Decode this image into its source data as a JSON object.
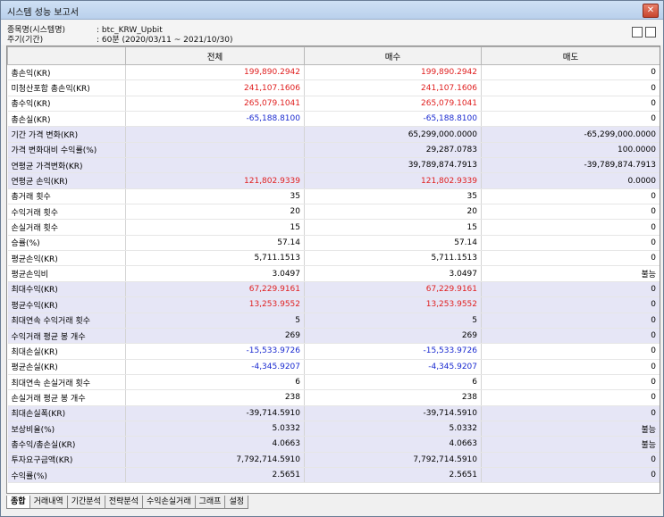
{
  "window": {
    "title": "시스템 성능 보고서",
    "close": "✕"
  },
  "info": {
    "name_label": "종목명(시스템명)",
    "name_value": ": btc_KRW_Upbit",
    "period_label": "주기(기간)",
    "period_value": ": 60분 (2020/03/11 ~ 2021/10/30)"
  },
  "table": {
    "headers": [
      "",
      "전체",
      "매수",
      "매도"
    ],
    "rows": [
      {
        "label": "총손익(KR)",
        "v": [
          "199,890.2942",
          "199,890.2942",
          "0"
        ],
        "c": [
          "red",
          "red",
          ""
        ],
        "hl": false
      },
      {
        "label": "미청산포함 총손익(KR)",
        "v": [
          "241,107.1606",
          "241,107.1606",
          "0"
        ],
        "c": [
          "red",
          "red",
          ""
        ],
        "hl": false
      },
      {
        "label": "총수익(KR)",
        "v": [
          "265,079.1041",
          "265,079.1041",
          "0"
        ],
        "c": [
          "red",
          "red",
          ""
        ],
        "hl": false
      },
      {
        "label": "총손실(KR)",
        "v": [
          "-65,188.8100",
          "-65,188.8100",
          "0"
        ],
        "c": [
          "blue",
          "blue",
          ""
        ],
        "hl": false
      },
      {
        "label": "기간 가격 변화(KR)",
        "v": [
          "",
          "65,299,000.0000",
          "-65,299,000.0000"
        ],
        "c": [
          "",
          "",
          ""
        ],
        "hl": true
      },
      {
        "label": "가격 변화대비 수익률(%)",
        "v": [
          "",
          "29,287.0783",
          "100.0000"
        ],
        "c": [
          "",
          "",
          ""
        ],
        "hl": true
      },
      {
        "label": "연평균 가격변화(KR)",
        "v": [
          "",
          "39,789,874.7913",
          "-39,789,874.7913"
        ],
        "c": [
          "",
          "",
          ""
        ],
        "hl": true
      },
      {
        "label": "연평균 손익(KR)",
        "v": [
          "121,802.9339",
          "121,802.9339",
          "0.0000"
        ],
        "c": [
          "red",
          "red",
          ""
        ],
        "hl": true
      },
      {
        "label": "총거래 횟수",
        "v": [
          "35",
          "35",
          "0"
        ],
        "c": [
          "",
          "",
          ""
        ],
        "hl": false
      },
      {
        "label": "수익거래 횟수",
        "v": [
          "20",
          "20",
          "0"
        ],
        "c": [
          "",
          "",
          ""
        ],
        "hl": false
      },
      {
        "label": "손실거래 횟수",
        "v": [
          "15",
          "15",
          "0"
        ],
        "c": [
          "",
          "",
          ""
        ],
        "hl": false
      },
      {
        "label": "승률(%)",
        "v": [
          "57.14",
          "57.14",
          "0"
        ],
        "c": [
          "",
          "",
          ""
        ],
        "hl": false
      },
      {
        "label": "평균손익(KR)",
        "v": [
          "5,711.1513",
          "5,711.1513",
          "0"
        ],
        "c": [
          "",
          "",
          ""
        ],
        "hl": false
      },
      {
        "label": "평균손익비",
        "v": [
          "3.0497",
          "3.0497",
          "불능"
        ],
        "c": [
          "",
          "",
          ""
        ],
        "hl": false
      },
      {
        "label": "최대수익(KR)",
        "v": [
          "67,229.9161",
          "67,229.9161",
          "0"
        ],
        "c": [
          "red",
          "red",
          ""
        ],
        "hl": true
      },
      {
        "label": "평균수익(KR)",
        "v": [
          "13,253.9552",
          "13,253.9552",
          "0"
        ],
        "c": [
          "red",
          "red",
          ""
        ],
        "hl": true
      },
      {
        "label": "최대연속 수익거래 횟수",
        "v": [
          "5",
          "5",
          "0"
        ],
        "c": [
          "",
          "",
          ""
        ],
        "hl": true
      },
      {
        "label": "수익거래 평균 봉 개수",
        "v": [
          "269",
          "269",
          "0"
        ],
        "c": [
          "",
          "",
          ""
        ],
        "hl": true
      },
      {
        "label": "최대손실(KR)",
        "v": [
          "-15,533.9726",
          "-15,533.9726",
          "0"
        ],
        "c": [
          "blue",
          "blue",
          ""
        ],
        "hl": false
      },
      {
        "label": "평균손실(KR)",
        "v": [
          "-4,345.9207",
          "-4,345.9207",
          "0"
        ],
        "c": [
          "blue",
          "blue",
          ""
        ],
        "hl": false
      },
      {
        "label": "최대연속 손실거래 횟수",
        "v": [
          "6",
          "6",
          "0"
        ],
        "c": [
          "",
          "",
          ""
        ],
        "hl": false
      },
      {
        "label": "손실거래 평균 봉 개수",
        "v": [
          "238",
          "238",
          "0"
        ],
        "c": [
          "",
          "",
          ""
        ],
        "hl": false
      },
      {
        "label": "최대손실폭(KR)",
        "v": [
          "-39,714.5910",
          "-39,714.5910",
          "0"
        ],
        "c": [
          "",
          "",
          ""
        ],
        "hl": true
      },
      {
        "label": "보상비율(%)",
        "v": [
          "5.0332",
          "5.0332",
          "불능"
        ],
        "c": [
          "",
          "",
          ""
        ],
        "hl": true
      },
      {
        "label": "총수익/총손실(KR)",
        "v": [
          "4.0663",
          "4.0663",
          "불능"
        ],
        "c": [
          "",
          "",
          ""
        ],
        "hl": true
      },
      {
        "label": "투자요구금액(KR)",
        "v": [
          "7,792,714.5910",
          "7,792,714.5910",
          "0"
        ],
        "c": [
          "",
          "",
          ""
        ],
        "hl": true
      },
      {
        "label": "수익률(%)",
        "v": [
          "2.5651",
          "2.5651",
          "0"
        ],
        "c": [
          "",
          "",
          ""
        ],
        "hl": true
      }
    ]
  },
  "tabs": [
    "종합",
    "거래내역",
    "기간분석",
    "전략분석",
    "수익손실거래",
    "그래프",
    "설정"
  ],
  "active_tab": 0
}
